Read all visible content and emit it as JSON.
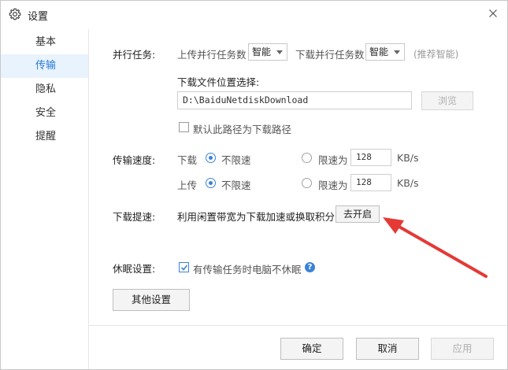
{
  "window": {
    "title": "设置"
  },
  "sidebar": {
    "items": [
      {
        "label": "基本"
      },
      {
        "label": "传输"
      },
      {
        "label": "隐私"
      },
      {
        "label": "安全"
      },
      {
        "label": "提醒"
      }
    ],
    "active_index": 1
  },
  "parallel": {
    "label": "并行任务:",
    "upload_label": "上传并行任务数",
    "upload_value": "智能",
    "download_label": "下载并行任务数",
    "download_value": "智能",
    "hint": "(推荐智能)"
  },
  "location": {
    "label": "下载文件位置选择:",
    "path": "D:\\BaiduNetdiskDownload",
    "browse_label": "浏览",
    "default_checkbox_label": "默认此路径为下载路径",
    "default_checked": false
  },
  "speed": {
    "label": "传输速度:",
    "download": {
      "label": "下载",
      "unlimited_label": "不限速",
      "unlimited_selected": true,
      "limit_label": "限速为",
      "limit_value": "128",
      "unit": "KB/s"
    },
    "upload": {
      "label": "上传",
      "unlimited_label": "不限速",
      "unlimited_selected": true,
      "limit_label": "限速为",
      "limit_value": "128",
      "unit": "KB/s"
    }
  },
  "boost": {
    "label": "下载提速:",
    "description": "利用闲置带宽为下载加速或换取积分",
    "button_label": "去开启"
  },
  "sleep": {
    "label": "休眠设置:",
    "checkbox_label": "有传输任务时电脑不休眠",
    "checked": true,
    "help": "?"
  },
  "other_settings_label": "其他设置",
  "footer": {
    "ok_label": "确定",
    "cancel_label": "取消",
    "apply_label": "应用"
  },
  "colors": {
    "accent": "#3b82d8",
    "active_nav_bg": "#e8f3fd",
    "annotation_arrow": "#e53935"
  }
}
